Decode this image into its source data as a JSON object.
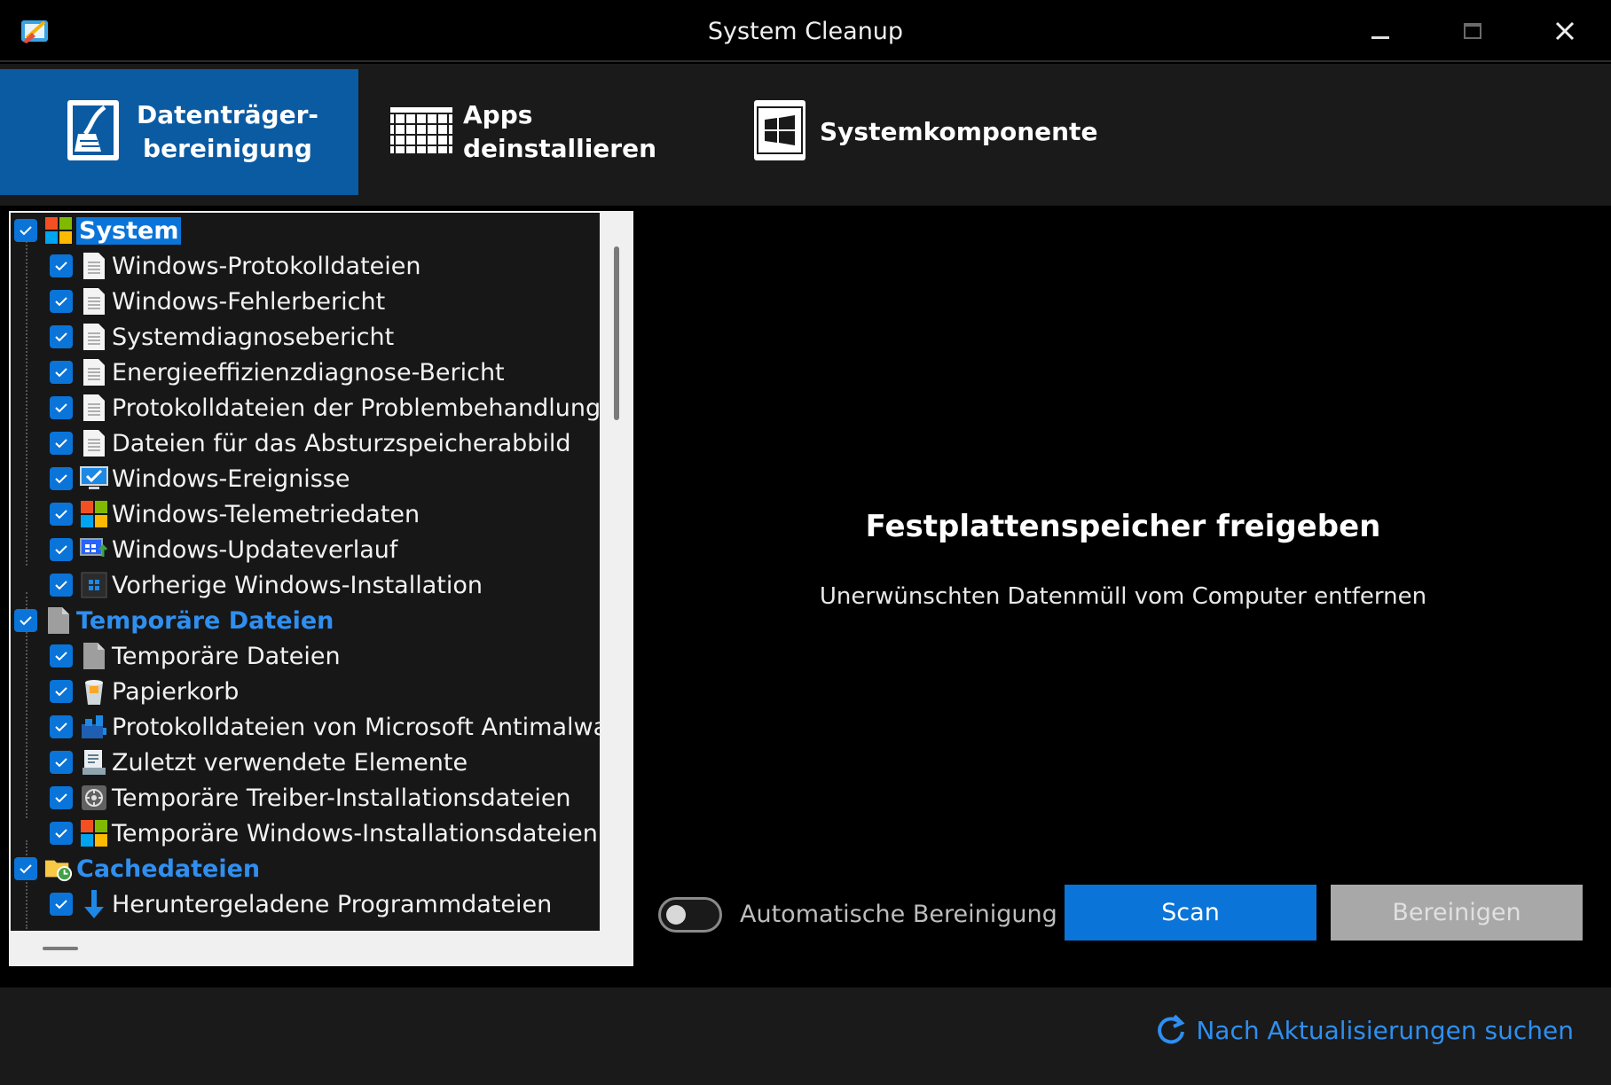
{
  "window": {
    "title": "System Cleanup"
  },
  "tabs": [
    {
      "label_line1": "Datenträger-",
      "label_line2": "bereinigung",
      "active": true,
      "icon": "disk-cleanup-icon"
    },
    {
      "label": "Apps deinstallieren",
      "icon": "apps-grid-icon"
    },
    {
      "label": "Systemkomponente",
      "icon": "windows-logo-icon"
    }
  ],
  "tree": {
    "groups": [
      {
        "label": "System",
        "icon": "windows-color-icon",
        "checked": true,
        "items": [
          {
            "label": "Windows-Protokolldateien",
            "icon": "document-icon"
          },
          {
            "label": "Windows-Fehlerbericht",
            "icon": "document-icon"
          },
          {
            "label": "Systemdiagnosebericht",
            "icon": "document-icon"
          },
          {
            "label": "Energieeffizienzdiagnose-Bericht",
            "icon": "document-icon"
          },
          {
            "label": "Protokolldateien der Problembehandlung",
            "icon": "document-icon"
          },
          {
            "label": "Dateien für das Absturzspeicherabbild",
            "icon": "document-icon"
          },
          {
            "label": "Windows-Ereignisse",
            "icon": "monitor-check-icon"
          },
          {
            "label": "Windows-Telemetriedaten",
            "icon": "windows-color-icon"
          },
          {
            "label": "Windows-Updateverlauf",
            "icon": "windows-update-icon"
          },
          {
            "label": "Vorherige Windows-Installation",
            "icon": "windows-install-icon"
          }
        ]
      },
      {
        "label": "Temporäre Dateien",
        "icon": "file-icon",
        "checked": true,
        "items": [
          {
            "label": "Temporäre Dateien",
            "icon": "file-icon"
          },
          {
            "label": "Papierkorb",
            "icon": "recycle-bin-icon"
          },
          {
            "label": "Protokolldateien von Microsoft Antimalware",
            "icon": "antimalware-icon"
          },
          {
            "label": "Zuletzt verwendete Elemente",
            "icon": "recent-items-icon"
          },
          {
            "label": "Temporäre Treiber-Installationsdateien",
            "icon": "driver-icon"
          },
          {
            "label": "Temporäre Windows-Installationsdateien",
            "icon": "windows-color-icon"
          }
        ]
      },
      {
        "label": "Cachedateien",
        "icon": "folder-clock-icon",
        "checked": true,
        "items": [
          {
            "label": "Heruntergeladene Programmdateien",
            "icon": "download-arrow-icon"
          }
        ]
      }
    ]
  },
  "main": {
    "heading": "Festplattenspeicher freigeben",
    "subtitle": "Unerwünschten Datenmüll vom Computer entfernen"
  },
  "controls": {
    "auto_label": "Automatische Bereinigung",
    "auto_enabled": false,
    "scan_label": "Scan",
    "clean_label": "Bereinigen"
  },
  "footer": {
    "update_label": "Nach Aktualisierungen suchen"
  },
  "colors": {
    "accent": "#0a74d8",
    "active_tab": "#0b5ba3",
    "link": "#2f8ff0",
    "disabled": "#a8a8a8"
  }
}
